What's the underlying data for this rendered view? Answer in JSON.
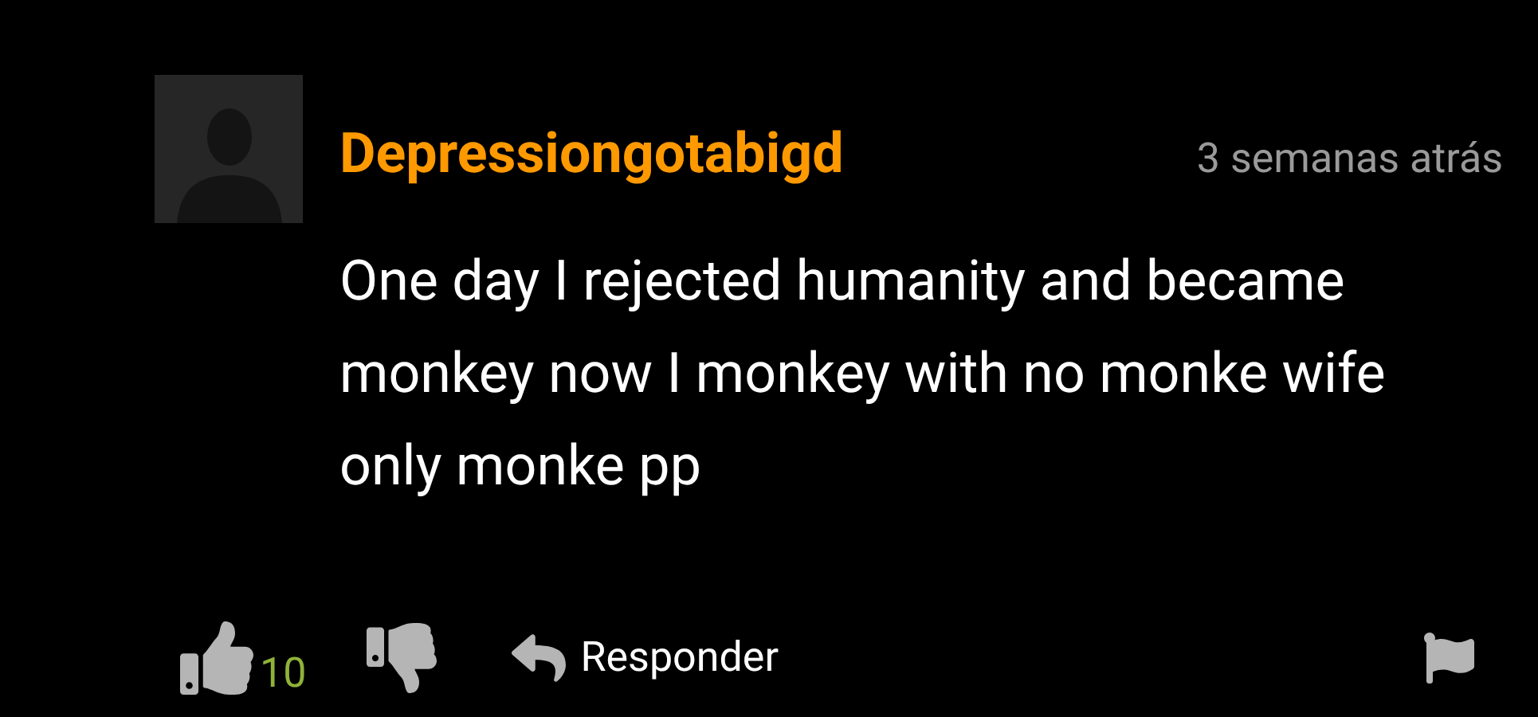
{
  "comment": {
    "author": "Depressiongotabigd",
    "time": "3 semanas atrás",
    "text": "One day I rejected humanity and became monkey now I monkey with no monke wife only monke pp",
    "likes": "10",
    "reply_label": "Responder"
  }
}
